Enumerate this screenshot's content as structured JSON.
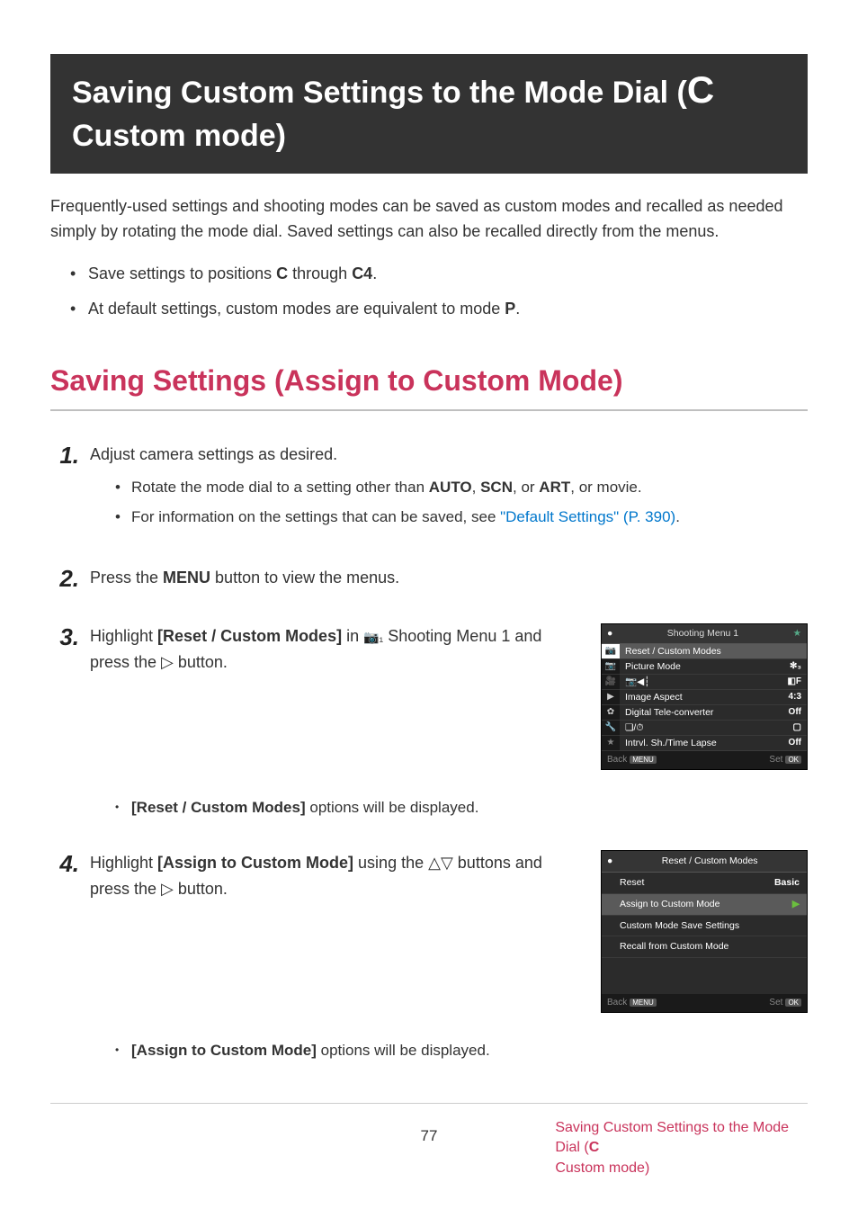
{
  "banner": {
    "line1_prefix": "Saving Custom Settings to the Mode Dial (",
    "line1_big": "C",
    "line2": "Custom mode)"
  },
  "intro": "Frequently-used settings and shooting modes can be saved as custom modes and recalled as needed simply by rotating the mode dial. Saved settings can also be recalled directly from the menus.",
  "bullets": [
    {
      "pre": "Save settings to positions ",
      "b1": "C",
      "mid": " through ",
      "b2": "C4",
      "post": "."
    },
    {
      "pre": "At default settings, custom modes are equivalent to mode ",
      "b1": "P",
      "mid": "",
      "b2": "",
      "post": "."
    }
  ],
  "section_heading": "Saving Settings (Assign to Custom Mode)",
  "steps": {
    "s1": {
      "num": "1.",
      "text": "Adjust camera settings as desired.",
      "sub": [
        {
          "pre": "Rotate the mode dial to a setting other than ",
          "b1": "AUTO",
          "sep1": ", ",
          "b2": "SCN",
          "sep2": ", or ",
          "b3": "ART",
          "post": ", or movie."
        },
        {
          "pre": "For information on the settings that can be saved, see ",
          "link": "\"Default Settings\" (P. 390)",
          "post": "."
        }
      ]
    },
    "s2": {
      "num": "2.",
      "pre": "Press the ",
      "b": "MENU",
      "post": " button to view the menus."
    },
    "s3": {
      "num": "3.",
      "pre": "Highlight ",
      "b": "[Reset / Custom Modes]",
      "mid": " in ",
      "icon": "📷₁",
      "post_icon": " Shooting Menu 1 and press the ",
      "tri": "▷",
      "post": " button.",
      "sub_after": {
        "b": "[Reset / Custom Modes]",
        "post": " options will be displayed."
      }
    },
    "s4": {
      "num": "4.",
      "pre": "Highlight ",
      "b": "[Assign to Custom Mode]",
      "mid": " using the ",
      "tri1": "△",
      "tri2": "▽",
      "mid2": " buttons and press the ",
      "tri3": "▷",
      "post": " button.",
      "sub_after": {
        "b": "[Assign to Custom Mode]",
        "post": " options will be displayed."
      }
    }
  },
  "menu1": {
    "header": "Shooting Menu 1",
    "rows": [
      {
        "label": "Reset / Custom Modes",
        "val": ""
      },
      {
        "label": "Picture Mode",
        "val": "✻₃"
      },
      {
        "label": "📷◀┆",
        "val": "◧F"
      },
      {
        "label": "Image Aspect",
        "val": "4:3"
      },
      {
        "label": "Digital Tele-converter",
        "val": "Off"
      },
      {
        "label": "❏/⏱",
        "val": "▢"
      },
      {
        "label": "Intrvl. Sh./Time Lapse",
        "val": "Off"
      }
    ],
    "back": "Back",
    "menu_btn": "MENU",
    "set": "Set",
    "ok_btn": "OK"
  },
  "menu2": {
    "header": "Reset / Custom Modes",
    "rows": [
      {
        "label": "Reset",
        "val": "Basic"
      },
      {
        "label": "Assign to Custom Mode",
        "val": "▶"
      },
      {
        "label": "Custom Mode Save Settings",
        "val": ""
      },
      {
        "label": "Recall from Custom Mode",
        "val": ""
      }
    ],
    "back": "Back",
    "menu_btn": "MENU",
    "set": "Set",
    "ok_btn": "OK"
  },
  "footer": {
    "page": "77",
    "link_pre": "Saving Custom Settings to the Mode Dial (",
    "link_big": "C",
    "link_post": " Custom mode)"
  }
}
